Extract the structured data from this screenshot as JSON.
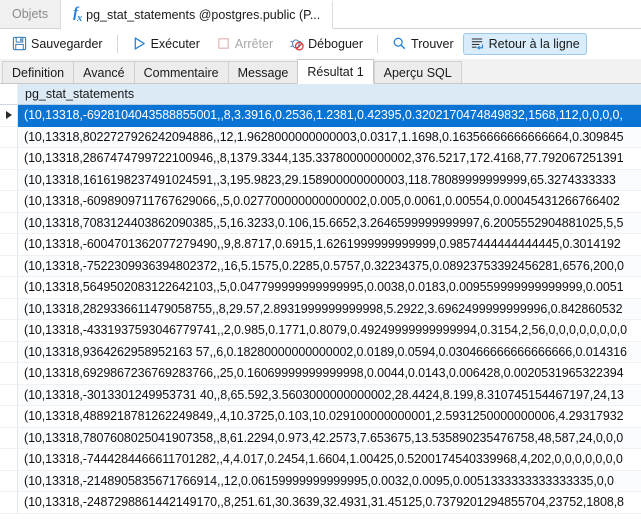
{
  "window": {
    "doc_tabs": [
      {
        "label": "Objets",
        "icon": "",
        "active": false
      },
      {
        "label": "pg_stat_statements @postgres.public (P...",
        "icon": "fx-icon",
        "active": true
      }
    ]
  },
  "toolbar": {
    "buttons": [
      {
        "label": "Sauvegarder",
        "icon": "save-icon",
        "state": "normal"
      },
      {
        "separator": true
      },
      {
        "label": "Exécuter",
        "icon": "play-icon",
        "state": "normal"
      },
      {
        "label": "Arrêter",
        "icon": "stop-icon",
        "state": "disabled"
      },
      {
        "label": "Déboguer",
        "icon": "debug-icon",
        "state": "normal"
      },
      {
        "separator": true
      },
      {
        "label": "Trouver",
        "icon": "search-icon",
        "state": "normal"
      },
      {
        "label": "Retour à la ligne",
        "icon": "word-wrap-icon",
        "state": "toggled"
      }
    ]
  },
  "subtabs": [
    {
      "label": "Definition",
      "active": false
    },
    {
      "label": "Avancé",
      "active": false
    },
    {
      "label": "Commentaire",
      "active": false
    },
    {
      "label": "Message",
      "active": false
    },
    {
      "label": "Résultat 1",
      "active": true
    },
    {
      "label": "Aperçu SQL",
      "active": false
    }
  ],
  "grid": {
    "columns": [
      "pg_stat_statements"
    ],
    "selected_row_index": 0,
    "rows": [
      "(10,13318,-6928104043588855001,,8,3.3916,0.2536,1.2381,0.42395,0.3202170474849832,1568,112,0,0,0,0,",
      "(10,13318,8022727926242094886,,12,1.9628000000000003,0.0317,1.1698,0.16356666666666664,0.309845",
      "(10,13318,2867474799722100946,,8,1379.3344,135.33780000000002,376.5217,172.4168,77.792067251391",
      "(10,13318,1616198237491024591,,3,195.9823,29.158900000000003,118.78089999999999,65.3274333333",
      "(10,13318,-6098909711767629066,,5,0.027700000000000002,0.005,0.0061,0.00554,0.00045431266766402",
      "(10,13318,7083124403862090385,,5,16.3233,0.106,15.6652,3.2646599999999997,6.2005552904881025,5,5",
      "(10,13318,-6004701362077279490,,9,8.8717,0.6915,1.6261999999999999,0.9857444444444445,0.3014192",
      "(10,13318,-7522309936394802372,,16,5.1575,0.2285,0.5757,0.32234375,0.08923753392456281,6576,200,0",
      "(10,13318,5649502083122642103,,5,0.047799999999999995,0.0038,0.0183,0.009559999999999999,0.0051",
      "(10,13318,2829336611479058755,,8,29.57,2.8931999999999998,5.2922,3.6962499999999996,0.842860532",
      "(10,13318,-4331937593046779741,,2,0.985,0.1771,0.8079,0.49249999999999994,0.3154,2,56,0,0,0,0,0,0,0,0",
      "(10,13318,9364262958952163 57,,6,0.18280000000000002,0.0189,0.0594,0.030466666666666666,0.014316",
      "(10,13318,6929867236769283766,,25,0.16069999999999998,0.0044,0.0143,0.006428,0.0020531965322394",
      "(10,13318,-3013301249953731 40,,8,65.592,3.5603000000000002,28.4424,8.199,8.310745154467197,24,13",
      "(10,13318,4889218781262249849,,4,10.3725,0.103,10.029100000000001,2.5931250000000006,4.29317932",
      "(10,13318,7807608025041907358,,8,61.2294,0.973,42.2573,7.653675,13.535890235476758,48,587,24,0,0,0",
      "(10,13318,-7444284466611701282,,4,4.017,0.2454,1.6604,1.00425,0.5200174540339968,4,202,0,0,0,0,0,0,0",
      "(10,13318,-2148905835671766914,,12,0.06159999999999995,0.0032,0.0095,0.0051333333333333335,0,0",
      "(10,13318,-2487298861442149170,,8,251.61,30.3639,32.4931,31.45125,0.7379201294855704,23752,1808,8"
    ]
  },
  "colors": {
    "selection": "#0a74d4",
    "header_bg": "#dceaf6",
    "accent": "#1c7fd6",
    "toggle_bg": "#d8ecfb"
  }
}
